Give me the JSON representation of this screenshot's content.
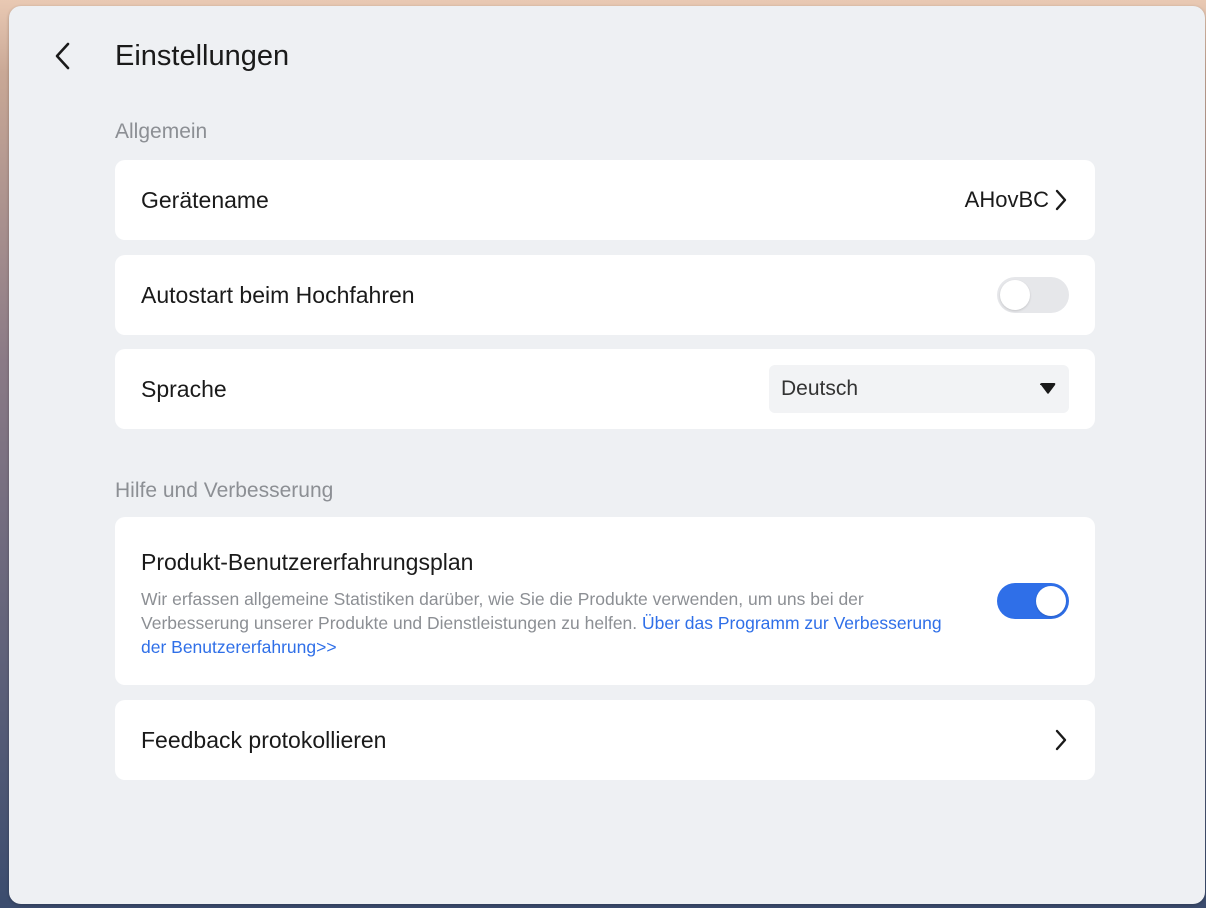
{
  "header": {
    "title": "Einstellungen",
    "back_icon": "chevron-left-icon"
  },
  "general": {
    "section_title": "Allgemein",
    "device_name": {
      "label": "Gerätename",
      "value": "AHovBC",
      "icon": "chevron-right-icon"
    },
    "autostart": {
      "label": "Autostart beim Hochfahren",
      "enabled": false
    },
    "language": {
      "label": "Sprache",
      "selected": "Deutsch",
      "icon": "caret-down-icon"
    }
  },
  "help": {
    "section_title": "Hilfe und Verbesserung",
    "experience_plan": {
      "title": "Produkt-Benutzererfahrungsplan",
      "description": "Wir erfassen allgemeine Statistiken darüber, wie Sie die Produkte verwenden, um uns bei der Verbesserung unserer Produkte und Dienstleistungen zu helfen. ",
      "link_text": "Über das Programm zur Verbesserung der Benutzererfahrung>>",
      "enabled": true
    },
    "feedback": {
      "label": "Feedback protokollieren",
      "icon": "chevron-right-icon"
    }
  },
  "colors": {
    "accent": "#2f6fe8",
    "card": "#ffffff",
    "background": "#eef0f3",
    "muted_text": "#8c8f94"
  }
}
